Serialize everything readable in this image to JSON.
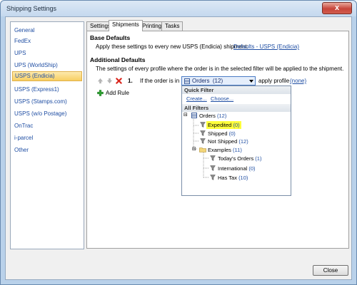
{
  "window": {
    "title": "Shipping Settings",
    "close_glyph": "x"
  },
  "sidebar": {
    "items": [
      {
        "label": "General"
      },
      {
        "label": "FedEx"
      },
      {
        "label": "UPS"
      },
      {
        "label": "UPS (WorldShip)"
      },
      {
        "label": "USPS (Endicia)",
        "selected": true
      },
      {
        "label": "USPS (Express1)"
      },
      {
        "label": "USPS (Stamps.com)"
      },
      {
        "label": "USPS (w/o Postage)"
      },
      {
        "label": "OnTrac"
      },
      {
        "label": "i-parcel"
      },
      {
        "label": "Other"
      }
    ]
  },
  "tabs": [
    {
      "label": "Settings"
    },
    {
      "label": "Shipments",
      "active": true
    },
    {
      "label": "Printing"
    },
    {
      "label": "Tasks"
    }
  ],
  "base_defaults": {
    "heading": "Base Defaults",
    "text": "Apply these settings to every new USPS (Endicia) shipment:",
    "link": "Defaults - USPS (Endicia)"
  },
  "additional_defaults": {
    "heading": "Additional Defaults",
    "text": "The settings of every profile where the order is in the selected filter will be applied to the shipment."
  },
  "rule": {
    "number": "1.",
    "prefix": "If the order is in",
    "filter_value": "Orders  (12)",
    "apply_text": "apply profile",
    "profile_link": "(none)"
  },
  "add_rule": "Add Rule",
  "dropdown": {
    "quick_filter_label": "Quick Filter",
    "create_link": "Create...",
    "choose_link": "Choose...",
    "all_filters_label": "All Filters",
    "tree": {
      "root": {
        "name": "Orders",
        "count": "(12)"
      },
      "children": [
        {
          "name": "Expedited",
          "count": "(0)",
          "highlighted": true
        },
        {
          "name": "Shipped",
          "count": "(0)"
        },
        {
          "name": "Not Shipped",
          "count": "(12)"
        }
      ],
      "folder": {
        "name": "Examples",
        "count": "(11)"
      },
      "folder_children": [
        {
          "name": "Today's Orders",
          "count": "(1)"
        },
        {
          "name": "International",
          "count": "(0)"
        },
        {
          "name": "Has Tax",
          "count": "(10)"
        }
      ]
    }
  },
  "footer": {
    "close_label": "Close"
  },
  "icons": {
    "move_up": "arrow-up-icon",
    "move_down": "arrow-down-icon",
    "delete": "delete-x-icon",
    "add": "add-plus-icon",
    "filter": "funnel-icon",
    "folder": "folder-icon",
    "grid": "filter-grid-icon"
  },
  "colors": {
    "link": "#1f4ea3",
    "highlight": "#ffff3c",
    "selected_item": "#f8cf61",
    "delete_red": "#d9251c",
    "add_green": "#2da131"
  }
}
